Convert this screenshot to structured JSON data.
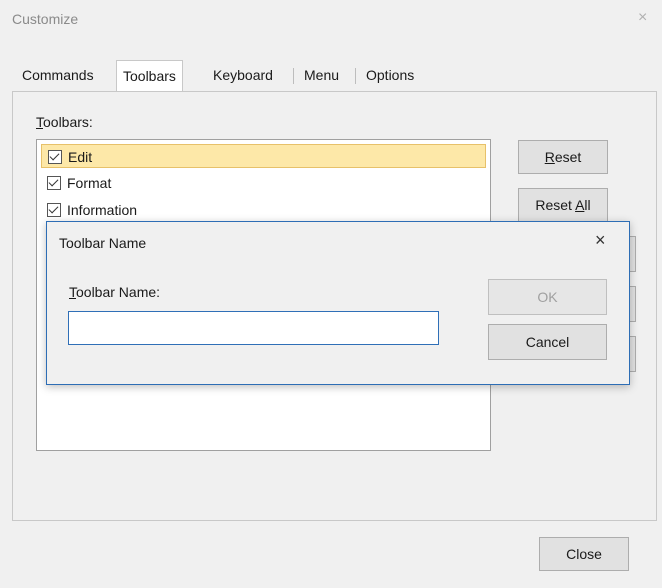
{
  "window": {
    "title": "Customize",
    "close_glyph": "×"
  },
  "tabs": [
    {
      "label": "Commands",
      "active": false
    },
    {
      "label": "Toolbars",
      "active": true
    },
    {
      "label": "Keyboard",
      "active": false
    },
    {
      "label": "Menu",
      "active": false
    },
    {
      "label": "Options",
      "active": false
    }
  ],
  "toolbars_panel": {
    "label_accel": "T",
    "label_rest": "oolbars:",
    "items": [
      {
        "label": "Edit",
        "checked": true,
        "selected": true
      },
      {
        "label": "Format",
        "checked": true,
        "selected": false
      },
      {
        "label": "Information",
        "checked": true,
        "selected": false
      }
    ],
    "reset_accel": "R",
    "reset_rest": "eset",
    "reset_all_prefix": "Reset ",
    "reset_all_accel": "A",
    "reset_all_rest": "ll"
  },
  "dialog": {
    "title": "Toolbar Name",
    "close_glyph": "×",
    "field_label_accel": "T",
    "field_label_rest": "oolbar Name:",
    "field_value": "",
    "ok_label": "OK",
    "cancel_label": "Cancel"
  },
  "footer": {
    "close_label": "Close"
  },
  "colors": {
    "selection_fill": "#fde8a8",
    "dialog_border": "#2d6db5"
  }
}
